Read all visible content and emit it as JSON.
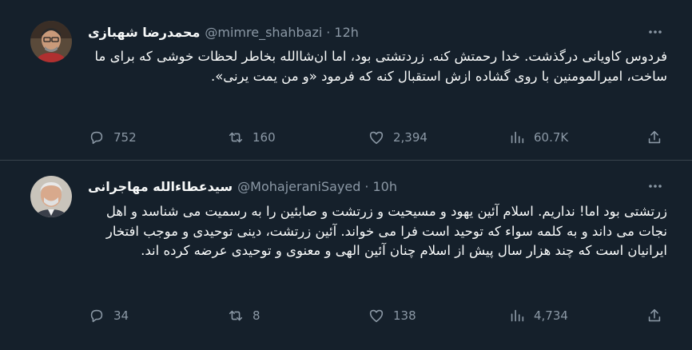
{
  "tweets": [
    {
      "display_name": "محمدرضا شهبازی",
      "handle": "@mimre_shahbazi",
      "time": "12h",
      "text": "فردوس کاویانی درگذشت. خدا رحمتش کنه. زردتشتی بود، اما ان‌شاالله بخاطر لحظات خوشی که برای ما ساخت، امیرالمومنین با روی گشاده ازش استقبال کنه که فرمود «و من یمت یرنی».",
      "replies": "752",
      "retweets": "160",
      "likes": "2,394",
      "views": "60.7K"
    },
    {
      "display_name": "سیدعطاءالله مهاجرانی",
      "handle": "@MohajeraniSayed",
      "time": "10h",
      "text": "زرتشتی بود اما! نداریم. اسلام آئین یهود و مسیحیت و زرتشت و صابئین را به  رسمیت می شناسد و اهل نجات می داند و به کلمه سواء که توحید است فرا می خواند. آئین زرتشت، دینی توحیدی و موجب افتخار ایرانیان است که چند هزار سال پیش از اسلام چنان آئین الهی و معنوی و توحیدی عرضه کرده اند.",
      "replies": "34",
      "retweets": "8",
      "likes": "138",
      "views": "4,734"
    }
  ],
  "separator": "·",
  "icons": [
    "more-icon",
    "reply-icon",
    "retweet-icon",
    "like-icon",
    "views-icon",
    "share-icon"
  ],
  "colors": {
    "background": "#15202b",
    "text": "#f7f9f9",
    "muted": "#8b98a5",
    "border": "#38444d"
  }
}
